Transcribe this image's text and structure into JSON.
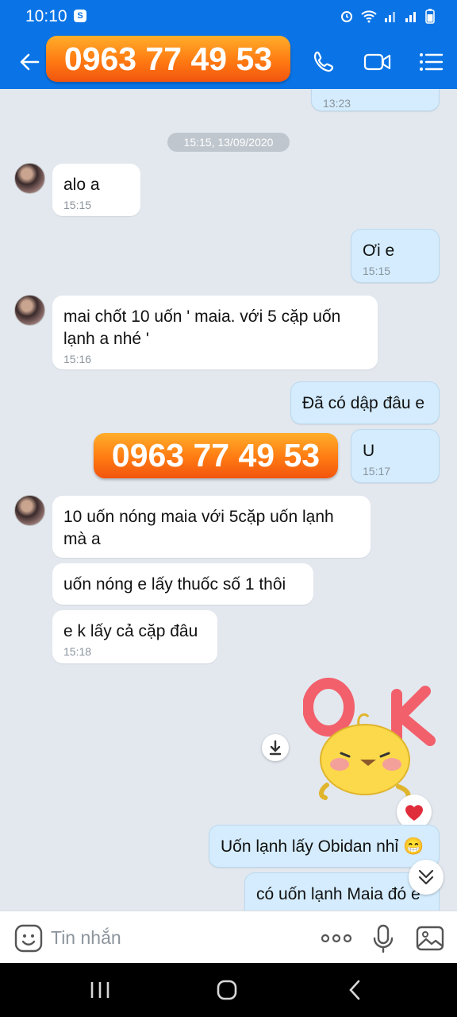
{
  "status_bar": {
    "time": "10:10",
    "notification_badge": "S"
  },
  "header": {
    "phone_banner": "0963 77 49 53"
  },
  "chat": {
    "partial_message_time": "13:23",
    "date_separator": "15:15, 13/09/2020",
    "messages": [
      {
        "side": "in",
        "text": "alo a",
        "time": "15:15"
      },
      {
        "side": "out",
        "text": "Ơi e",
        "time": "15:15"
      },
      {
        "side": "in",
        "text": " mai chốt  10 uốn ' maia. với 5 cặp uốn lạnh a nhé '",
        "time": "15:16"
      },
      {
        "side": "out",
        "text": "Đã có dập đâu e",
        "time": ""
      },
      {
        "side": "out",
        "text": "U",
        "time": "15:17"
      },
      {
        "side": "in",
        "text": "  10 uốn nóng maia với 5cặp uốn lạnh mà a",
        "time": ""
      },
      {
        "side": "in",
        "text": " uốn nóng e lấy thuốc số 1 thôi",
        "time": ""
      },
      {
        "side": "in",
        "text": " e k lấy cả cặp đâu",
        "time": "15:18"
      },
      {
        "side": "out",
        "text": "Uốn lạnh lấy Obidan nhỉ 😁",
        "time": ""
      },
      {
        "side": "out",
        "text": "có uốn lạnh Maia đó e",
        "time": ""
      }
    ],
    "middle_banner": "0963 77 49 53",
    "sticker_text": "OK"
  },
  "input_bar": {
    "placeholder": "Tin nhắn"
  },
  "colors": {
    "header_blue": "#0a74e6",
    "outgoing_bubble": "#d4ecfd",
    "incoming_bubble": "#ffffff",
    "chat_background": "#e3e8ef",
    "banner_orange": "#ff7a12",
    "sticker_pink": "#f2606b",
    "sticker_yellow": "#fbd94a"
  },
  "icons": {
    "back": "arrow-left-icon",
    "call": "phone-icon",
    "video": "video-camera-icon",
    "menu": "list-icon",
    "sticker": "smiley-icon",
    "more": "more-dots-icon",
    "voice": "microphone-icon",
    "gallery": "image-icon",
    "download": "download-icon",
    "reaction": "heart-icon",
    "scroll_down": "double-chevron-down-icon"
  }
}
